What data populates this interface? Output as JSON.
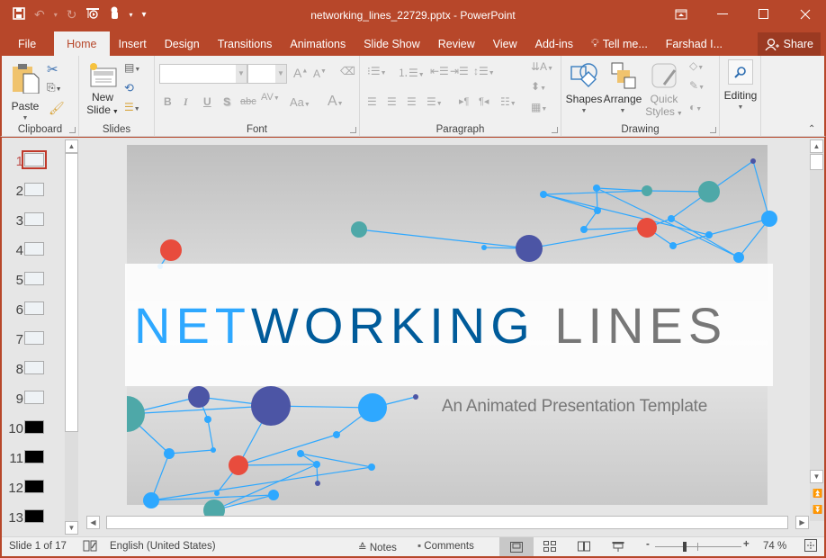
{
  "window": {
    "title": "networking_lines_22729.pptx - PowerPoint",
    "controls": [
      "ribbon-display-options",
      "minimize",
      "maximize",
      "close"
    ]
  },
  "quick_access": {
    "items": [
      {
        "name": "save-icon",
        "glyph": "💾"
      },
      {
        "name": "undo-icon",
        "glyph": "↶"
      },
      {
        "name": "redo-icon",
        "glyph": "↻"
      },
      {
        "name": "start-from-beginning-icon",
        "glyph": "⎚"
      },
      {
        "name": "touch-mode-icon",
        "glyph": "☝"
      },
      {
        "name": "customize-qat-icon",
        "glyph": "▾"
      }
    ]
  },
  "tabs": [
    "File",
    "Home",
    "Insert",
    "Design",
    "Transitions",
    "Animations",
    "Slide Show",
    "Review",
    "View",
    "Add-ins"
  ],
  "active_tab": "Home",
  "tell_me": "Tell me...",
  "user": "Farshad I...",
  "share_label": "Share",
  "ribbon": {
    "clipboard": {
      "label": "Clipboard",
      "paste": "Paste"
    },
    "slides": {
      "label": "Slides",
      "new_slide_1": "New",
      "new_slide_2": "Slide"
    },
    "font": {
      "label": "Font",
      "font_name": "",
      "font_size": ""
    },
    "paragraph": {
      "label": "Paragraph"
    },
    "drawing": {
      "label": "Drawing",
      "shapes": "Shapes",
      "arrange": "Arrange",
      "quick_styles_1": "Quick",
      "quick_styles_2": "Styles"
    },
    "editing": {
      "label": "Editing"
    }
  },
  "thumbnails": [
    {
      "num": "1",
      "selected": true,
      "dark": false
    },
    {
      "num": "2",
      "selected": false,
      "dark": false
    },
    {
      "num": "3",
      "selected": false,
      "dark": false
    },
    {
      "num": "4",
      "selected": false,
      "dark": false
    },
    {
      "num": "5",
      "selected": false,
      "dark": false
    },
    {
      "num": "6",
      "selected": false,
      "dark": false
    },
    {
      "num": "7",
      "selected": false,
      "dark": false
    },
    {
      "num": "8",
      "selected": false,
      "dark": false
    },
    {
      "num": "9",
      "selected": false,
      "dark": false
    },
    {
      "num": "10",
      "selected": false,
      "dark": true
    },
    {
      "num": "11",
      "selected": false,
      "dark": true
    },
    {
      "num": "12",
      "selected": false,
      "dark": true
    },
    {
      "num": "13",
      "selected": false,
      "dark": true
    }
  ],
  "slide": {
    "title_part1": "NET",
    "title_part2": "WORKING",
    "title_part3": " LINES",
    "subtitle": "An Animated Presentation Template",
    "colors": {
      "light_blue": "#2ea8ff",
      "dark_blue": "#005b9a",
      "gray": "#777777",
      "teal": "#4ea8a8",
      "red": "#e84c3d",
      "indigo": "#4c55a5",
      "line": "#2ea8ff"
    }
  },
  "status": {
    "slide_info": "Slide 1 of 17",
    "language": "English (United States)",
    "notes": "Notes",
    "comments": "Comments",
    "zoom": "74 %",
    "zoom_level": 0.74
  }
}
